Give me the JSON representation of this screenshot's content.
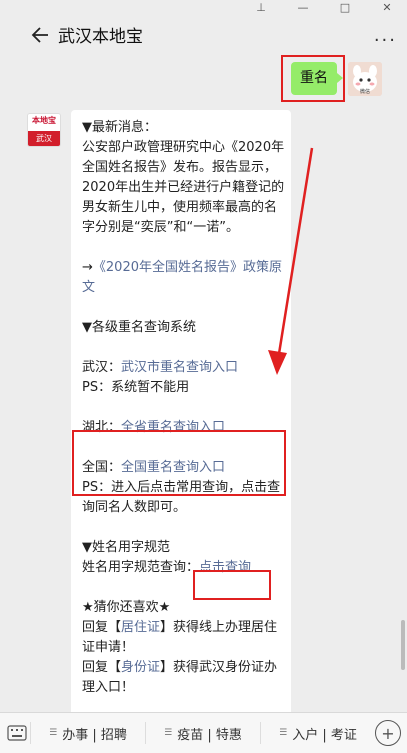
{
  "window_controls": [
    "pin-icon",
    "minimize-icon",
    "maximize-icon",
    "close-icon"
  ],
  "nav": {
    "title": "武汉本地宝",
    "more": "···"
  },
  "user_message": {
    "text": "重名",
    "avatar_label": "微信"
  },
  "bot_avatar": {
    "top_text": "本地宝",
    "bottom_text": "武汉"
  },
  "message": {
    "latest_header": "▼最新消息：",
    "latest_body": "公安部户政管理研究中心《2020年全国姓名报告》发布。报告显示，2020年出生并已经进行户籍登记的男女新生儿中，使用频率最高的名字分别是“奕辰”和“一诺”。",
    "report_arrow": "→",
    "report_link": "《2020年全国姓名报告》政策原文",
    "query_header": "▼各级重名查询系统",
    "wuhan_label": "武汉：",
    "wuhan_link": "武汉市重名查询入口",
    "wuhan_ps": "PS：系统暂不能用",
    "hubei_label": "湖北：",
    "hubei_link": "全省重名查询入口",
    "national_label": "全国：",
    "national_link": "全国重名查询入口",
    "national_ps": "PS：进入后点击常用查询，点击查询同名人数即可。",
    "standard_header": "▼姓名用字规范",
    "standard_label": "姓名用字规范查询：",
    "standard_link": "点击查询",
    "guess_header": "★猜你还喜欢★",
    "reply1_prefix": "回复【",
    "reply1_keyword": "居住证",
    "reply1_suffix": "】获得线上办理居住证申请！",
    "reply2_prefix": "回复【",
    "reply2_keyword": "身份证",
    "reply2_suffix": "】获得武汉身份证办理入口！"
  },
  "bottom_menu": [
    {
      "label": "办事 | 招聘"
    },
    {
      "label": "疫苗 | 特惠"
    },
    {
      "label": "入户 | 考证"
    }
  ],
  "colors": {
    "accent_link": "#576b95",
    "highlight": "#e02020",
    "user_bubble": "#95ec69"
  }
}
